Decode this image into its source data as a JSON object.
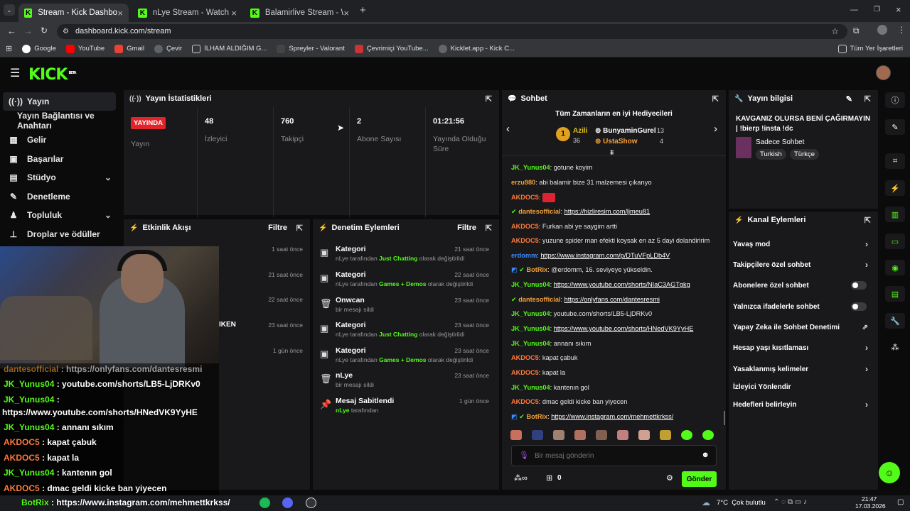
{
  "browser": {
    "tabs": [
      {
        "title": "Stream - Kick Dashboard",
        "active": true
      },
      {
        "title": "nLye Stream - Watch Live on Ki",
        "active": false
      },
      {
        "title": "Balamirlive Stream - Watch Live",
        "active": false
      }
    ],
    "url": "dashboard.kick.com/stream",
    "bookmarks": [
      "Google",
      "YouTube",
      "Gmail",
      "Çevir",
      "İLHAM ALDIĞIM G...",
      "Spreyler - Valorant",
      "Çevrimiçi YouTube...",
      "Kicklet.app - Kick C..."
    ],
    "bookmarks_right": "Tüm Yer İşaretleri"
  },
  "kick": {
    "logo": "KICK",
    "beta": "BETA"
  },
  "sidebar": {
    "items": [
      {
        "label": "Yayın",
        "icon": "stream-icon"
      },
      {
        "label": "Yayın Bağlantısı ve Anahtarı",
        "icon": ""
      },
      {
        "label": "Gelir",
        "icon": "revenue-icon"
      },
      {
        "label": "Başarılar",
        "icon": "achievements-icon"
      },
      {
        "label": "Stüdyo",
        "icon": "studio-icon"
      },
      {
        "label": "Denetleme",
        "icon": "moderation-icon"
      },
      {
        "label": "Topluluk",
        "icon": "community-icon"
      },
      {
        "label": "Droplar ve ödüller",
        "icon": "drops-icon"
      }
    ]
  },
  "stats": {
    "title": "Yayın İstatistikleri",
    "live_badge": "YAYINDA",
    "live_label": "Yayın",
    "viewers": "48",
    "viewers_label": "İzleyici",
    "followers": "760",
    "followers_label": "Takipçi",
    "subs": "2",
    "subs_label": "Abone Sayısı",
    "uptime": "01:21:56",
    "uptime_label": "Yayında Olduğu Süre"
  },
  "activity": {
    "title": "Etkinlik Akışı",
    "filter": "Filtre",
    "times": [
      "1 saat önce",
      "21 saat önce",
      "22 saat önce",
      "23 saat önce",
      "1 gün önce"
    ],
    "partial": "IKEN"
  },
  "moderation": {
    "title": "Denetim Eylemleri",
    "filter": "Filtre",
    "items": [
      {
        "title": "Kategori",
        "pre": "nLye tarafından ",
        "hl": "Just Chatting",
        "post": " olarak değiştirildi",
        "time": "21 saat önce"
      },
      {
        "title": "Kategori",
        "pre": "nLye tarafından ",
        "hl": "Games + Demos",
        "post": " olarak değiştirildi",
        "time": "22 saat önce"
      },
      {
        "title": "Onwcan",
        "pre": "bir mesajı sildi",
        "hl": "",
        "post": "",
        "time": "23 saat önce"
      },
      {
        "title": "Kategori",
        "pre": "nLye tarafından ",
        "hl": "Just Chatting",
        "post": " olarak değiştirildi",
        "time": "23 saat önce"
      },
      {
        "title": "Kategori",
        "pre": "nLye tarafından ",
        "hl": "Games + Demos",
        "post": " olarak değiştirildi",
        "time": "23 saat önce"
      },
      {
        "title": "nLye",
        "pre": "bir mesajı sildi",
        "hl": "",
        "post": "",
        "time": "23 saat önce"
      },
      {
        "title": "Mesaj Sabitlendi",
        "pre": "",
        "hl": "nLye",
        "post": " tarafından",
        "time": "1 gün önce"
      }
    ]
  },
  "chat": {
    "title": "Sohbet",
    "gifters_title": "Tüm Zamanların en iyi Hediyecileri",
    "gifters": [
      {
        "rank": "1",
        "name": "Azili",
        "count": "36"
      },
      {
        "name": "BunyaminGurel",
        "count": "13"
      },
      {
        "name": "UstaShow",
        "count": "4"
      }
    ],
    "messages": [
      {
        "user": "JK_Yunus04",
        "color": "#53fc18",
        "text": "gotune koyim",
        "link": false
      },
      {
        "user": "erzu980",
        "color": "#f4a13a",
        "text": "abi balamir bize 31 malzemesi çıkarıyo",
        "link": false
      },
      {
        "user": "AKDOC5",
        "color": "#ff7a3a",
        "text": "",
        "link": false
      },
      {
        "user": "dantesofficial",
        "color": "#f4a13a",
        "text": "https://hizliresim.com/ljmeu81",
        "link": true
      },
      {
        "user": "AKDOC5",
        "color": "#ff7a3a",
        "text": "Furkan abi ye saygim artti",
        "link": false
      },
      {
        "user": "AKDOC5",
        "color": "#ff7a3a",
        "text": "yuzune spider man efekti koysak en az 5 dayi dolandiririm",
        "link": false
      },
      {
        "user": "erdomm",
        "color": "#3a8cff",
        "text": "https://www.instagram.com/p/DTuVFpLDb4V",
        "link": true
      },
      {
        "user": "BotRix",
        "color": "#f4a13a",
        "text": "@erdomm, 16. seviyeye yükseldin.",
        "link": false
      },
      {
        "user": "JK_Yunus04",
        "color": "#53fc18",
        "text": "https://www.youtube.com/shorts/NIaC3AGTgkg",
        "link": true
      },
      {
        "user": "dantesofficial",
        "color": "#f4a13a",
        "text": "https://onlyfans.com/dantesresmi",
        "link": true
      },
      {
        "user": "JK_Yunus04",
        "color": "#53fc18",
        "text": "youtube.com/shorts/LB5-LjDRKv0",
        "link": false
      },
      {
        "user": "JK_Yunus04",
        "color": "#53fc18",
        "text": "https://www.youtube.com/shorts/HNedVK9YyHE",
        "link": true
      },
      {
        "user": "JK_Yunus04",
        "color": "#53fc18",
        "text": "annanı sıkım",
        "link": false
      },
      {
        "user": "AKDOC5",
        "color": "#ff7a3a",
        "text": "kapat çabuk",
        "link": false
      },
      {
        "user": "AKDOC5",
        "color": "#ff7a3a",
        "text": "kapat la",
        "link": false
      },
      {
        "user": "JK_Yunus04",
        "color": "#53fc18",
        "text": "kantenın gol",
        "link": false
      },
      {
        "user": "AKDOC5",
        "color": "#ff7a3a",
        "text": "dmac geldi kicke ban yiyecen",
        "link": false
      },
      {
        "user": "BotRix",
        "color": "#f4a13a",
        "text": "https://www.instagram.com/mehmettkrkss/",
        "link": true
      }
    ],
    "input_placeholder": "Bir mesaj gönderin",
    "points": "0",
    "send": "Gönder"
  },
  "stream_info": {
    "title": "Yayın bilgisi",
    "stream_title": "KAVGANIZ OLURSA BENİ ÇAĞIRMAYIN | !bierp !insta !dc",
    "category": "Sadece Sohbet",
    "tags": [
      "Turkish",
      "Türkçe"
    ]
  },
  "channel_actions": {
    "title": "Kanal Eylemleri",
    "items": [
      {
        "label": "Yavaş mod",
        "type": "chevron"
      },
      {
        "label": "Takipçilere özel sohbet",
        "type": "chevron"
      },
      {
        "label": "Abonelere özel sohbet",
        "type": "toggle"
      },
      {
        "label": "Yalnızca ifadelerle sohbet",
        "type": "toggle"
      },
      {
        "label": "Yapay Zeka ile Sohbet Denetimi",
        "type": "external"
      },
      {
        "label": "Hesap yaşı kısıtlaması",
        "type": "chevron"
      },
      {
        "label": "Yasaklanmış kelimeler",
        "type": "chevron"
      },
      {
        "label": "İzleyici Yönlendir",
        "type": "none"
      },
      {
        "label": "Hedefleri belirleyin",
        "type": "chevron"
      }
    ]
  },
  "overlay_chat": [
    {
      "user": "dantesofficial",
      "color": "#f4a13a",
      "text": " : https://onlyfans.com/dantesresmi"
    },
    {
      "user": "JK_Yunus04",
      "color": "#53fc18",
      "text": " : youtube.com/shorts/LB5-LjDRKv0"
    },
    {
      "user": "JK_Yunus04",
      "color": "#53fc18",
      "text": " :"
    },
    {
      "user": "",
      "color": "#fff",
      "text": "https://www.youtube.com/shorts/HNedVK9YyHE"
    },
    {
      "user": "JK_Yunus04",
      "color": "#53fc18",
      "text": " : annanı sıkım"
    },
    {
      "user": "AKDOC5",
      "color": "#ff7a3a",
      "text": " : kapat çabuk"
    },
    {
      "user": "AKDOC5",
      "color": "#ff7a3a",
      "text": " : kapat la"
    },
    {
      "user": "JK_Yunus04",
      "color": "#53fc18",
      "text": " : kantenın gol"
    },
    {
      "user": "AKDOC5",
      "color": "#ff7a3a",
      "text": " : dmac geldi kicke ban yiyecen"
    },
    {
      "user": "BotRix",
      "color": "#53fc18",
      "text": " : https://www.instagram.com/mehmettkrkss/"
    }
  ],
  "taskbar": {
    "weather": "7°C  Çok bulutlu",
    "time": "21:47",
    "date": "17.03.2026"
  }
}
